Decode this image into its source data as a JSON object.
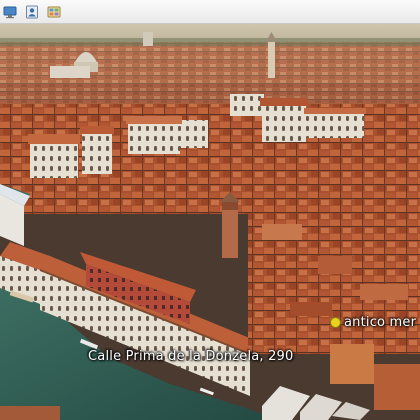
{
  "toolbar": {
    "buttons": [
      {
        "icon": "monitor-icon"
      },
      {
        "icon": "person-card-icon"
      },
      {
        "icon": "photo-gallery-icon"
      }
    ]
  },
  "map": {
    "view": "3D aerial",
    "labels": {
      "primary": "Calle Prima de la Donzela, 290",
      "secondary": "antico mer"
    },
    "colors": {
      "roofs": "#b5532e",
      "water": "#2f5d52",
      "haze": "#c9c0a8",
      "pin": "#e8d31f"
    }
  }
}
